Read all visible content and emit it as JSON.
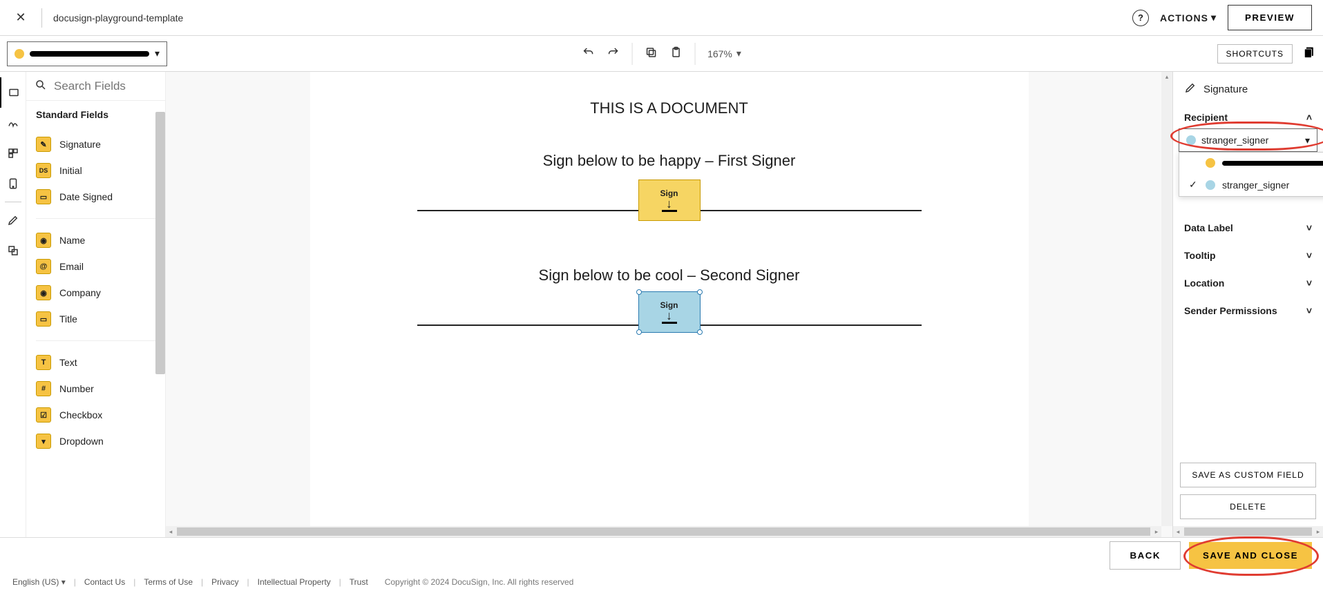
{
  "header": {
    "title": "docusign-playground-template",
    "actions_label": "ACTIONS",
    "preview_label": "PREVIEW"
  },
  "toolbar": {
    "zoom": "167%",
    "shortcuts_label": "SHORTCUTS"
  },
  "search": {
    "placeholder": "Search Fields"
  },
  "fields_panel": {
    "header": "Standard Fields",
    "group1": [
      {
        "icon": "✎",
        "label": "Signature"
      },
      {
        "icon": "DS",
        "label": "Initial"
      },
      {
        "icon": "▭",
        "label": "Date Signed"
      }
    ],
    "group2": [
      {
        "icon": "▭",
        "label": "Name"
      },
      {
        "icon": "@",
        "label": "Email"
      },
      {
        "icon": "▭",
        "label": "Company"
      },
      {
        "icon": "▭",
        "label": "Title"
      }
    ],
    "group3": [
      {
        "icon": "T",
        "label": "Text"
      },
      {
        "icon": "#",
        "label": "Number"
      },
      {
        "icon": "☑",
        "label": "Checkbox"
      },
      {
        "icon": "▾",
        "label": "Dropdown"
      }
    ]
  },
  "document": {
    "heading": "THIS IS A DOCUMENT",
    "signer1_text": "Sign below to be happy – First Signer",
    "signer2_text": "Sign below to be cool – Second Signer",
    "sign_label": "Sign"
  },
  "right_panel": {
    "title": "Signature",
    "recipient_label": "Recipient",
    "selected_recipient": "stranger_signer",
    "options": {
      "opt2": "stranger_signer"
    },
    "sections": {
      "data_label": "Data Label",
      "tooltip": "Tooltip",
      "location": "Location",
      "sender_permissions": "Sender Permissions"
    },
    "save_custom": "SAVE AS CUSTOM FIELD",
    "delete": "DELETE"
  },
  "bottom": {
    "back": "BACK",
    "save_close": "SAVE AND CLOSE"
  },
  "footer": {
    "lang": "English (US)",
    "contact": "Contact Us",
    "terms": "Terms of Use",
    "privacy": "Privacy",
    "ip": "Intellectual Property",
    "trust": "Trust",
    "copyright": "Copyright © 2024 DocuSign, Inc. All rights reserved"
  }
}
